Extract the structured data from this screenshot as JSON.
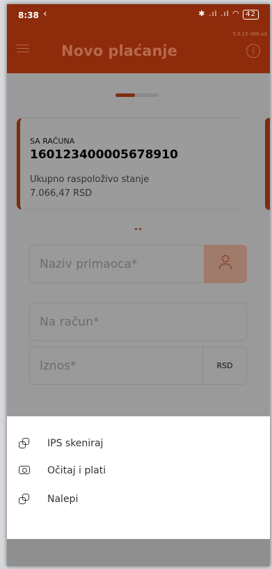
{
  "status": {
    "time": "8:38",
    "back_glyph": "‹",
    "icons": "✱ .ıl .ıl ◠",
    "battery": "42",
    "version": "5.0.15-366-ud"
  },
  "header": {
    "title": "Novo plaćanje",
    "info_glyph": "i"
  },
  "account_card": {
    "label": "SA RAČUNA",
    "number": "160123400005678910",
    "available_label": "Ukupno raspoloživo stanje",
    "available_balance": "7.066,47 RSD"
  },
  "form": {
    "recipient_label": "Naziv primaoca*",
    "account_label": "Na račun*",
    "amount_label": "Iznos*",
    "currency": "RSD"
  },
  "sheet": {
    "items": [
      {
        "label": "IPS skeniraj",
        "icon": "link-icon"
      },
      {
        "label": "Očitaj i plati",
        "icon": "camera-icon"
      },
      {
        "label": "Nalepi",
        "icon": "link-icon"
      }
    ]
  },
  "colors": {
    "header": "#8d2b0b",
    "accent": "#7c2d10",
    "sheet": "#ffffff"
  }
}
